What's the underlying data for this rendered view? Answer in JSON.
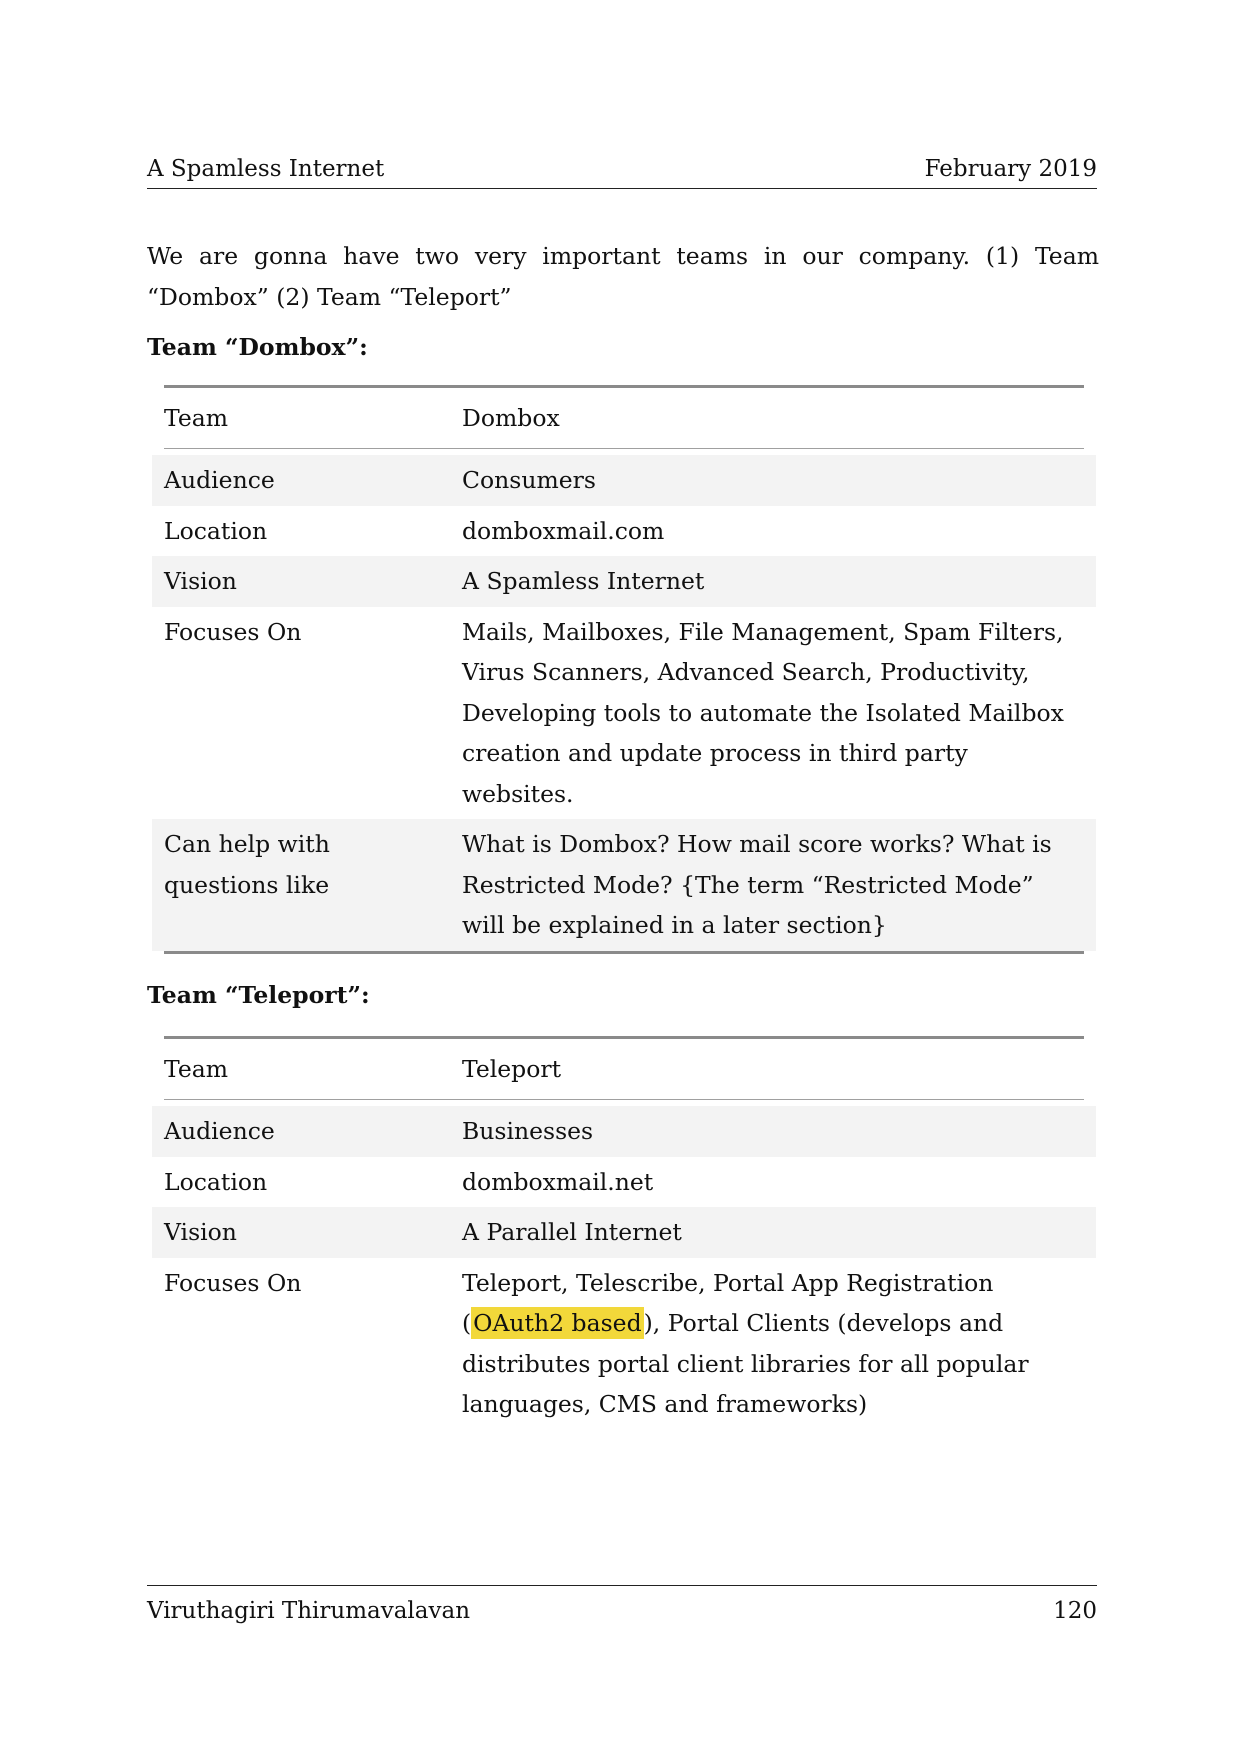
{
  "header": {
    "left": "A Spamless Internet",
    "right": "February 2019"
  },
  "intro": "We are gonna have two very important teams in our company.  (1) Team “Dombox” (2) Team “Teleport”",
  "dombox": {
    "title": "Team “Dombox”:",
    "header_label": "Team",
    "header_value": "Dombox",
    "rows": [
      {
        "label": "Audience",
        "value": "Consumers"
      },
      {
        "label": "Location",
        "value": "domboxmail.com"
      },
      {
        "label": "Vision",
        "value": "A Spamless Internet"
      },
      {
        "label": "Focuses On",
        "value": "Mails, Mailboxes, File Management, Spam Filters, Virus Scanners, Advanced Search, Productivity, Developing tools to automate the Isolated Mailbox creation and update process in third party websites."
      },
      {
        "label": "Can help with questions like",
        "value": "What is Dombox? How mail score works? What is Restricted Mode? {The term “Restricted Mode” will be explained in a later section}"
      }
    ]
  },
  "teleport": {
    "title": "Team “Teleport”:",
    "header_label": "Team",
    "header_value": "Teleport",
    "rows": [
      {
        "label": "Audience",
        "value": "Businesses"
      },
      {
        "label": "Location",
        "value": "domboxmail.net"
      },
      {
        "label": "Vision",
        "value": "A Parallel Internet"
      },
      {
        "label": "Focuses On",
        "value_before": "Teleport, Telescribe, Portal App Registration (",
        "value_highlight": "OAuth2 based",
        "value_after": "), Portal Clients (develops and distributes portal client libraries for all popular languages, CMS and frameworks)"
      }
    ]
  },
  "footer": {
    "left": "Viruthagiri Thirumavalavan",
    "right": "120"
  },
  "colors": {
    "highlight": "#f2d83a",
    "row_shade": "#f3f3f3"
  }
}
